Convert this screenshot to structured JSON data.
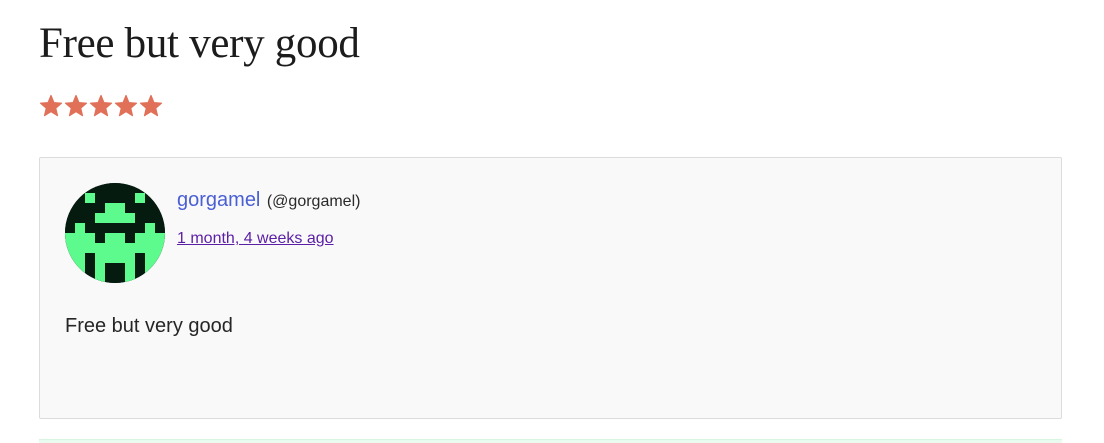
{
  "review": {
    "title": "Free but very good",
    "rating": 5,
    "rating_max": 5,
    "star_color": "#e07058",
    "body": "Free but very good"
  },
  "author": {
    "name": "gorgamel",
    "handle": "(@gorgamel)",
    "avatar": "pixel-alien-avatar",
    "avatar_bg": "#051b10",
    "avatar_fg": "#5dfb8d"
  },
  "meta": {
    "date": "1 month, 4 weeks ago"
  },
  "colors": {
    "link": "#4a5fd3",
    "visited_link": "#5b1fa5",
    "card_background": "#f9f9f9"
  }
}
